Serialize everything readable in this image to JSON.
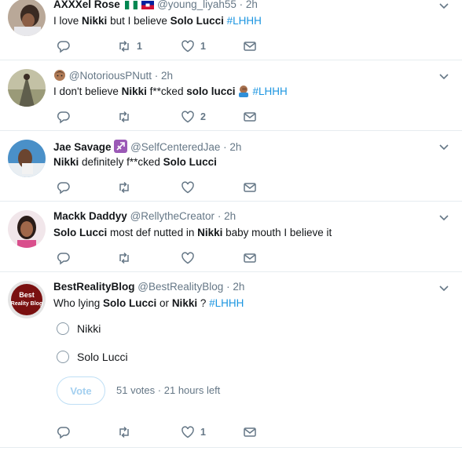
{
  "colors": {
    "accent": "#1b95e0",
    "meta": "#657786",
    "divider": "#e6ecf0"
  },
  "tweets": [
    {
      "name": "AXXXel Rose",
      "flags": [
        "nigeria-flag",
        "haiti-flag"
      ],
      "handle": "@young_liyah55",
      "time": "· 2h",
      "text": [
        {
          "t": "I love "
        },
        {
          "t": "Nikki",
          "b": true
        },
        {
          "t": " but I believe "
        },
        {
          "t": "Solo Lucci",
          "b": true
        },
        {
          "t": "  #LHHH",
          "tag": true
        }
      ],
      "retweets": "1",
      "likes": "1"
    },
    {
      "name": "@NotoriousPNutt",
      "time": "· 2h",
      "text": [
        {
          "t": "I don't believe "
        },
        {
          "t": "Nikki",
          "b": true
        },
        {
          "t": " f**cked "
        },
        {
          "t": "solo lucci",
          "b": true
        },
        {
          "t": "#LHHH",
          "tag": true
        }
      ],
      "retweets": "",
      "likes": "2"
    },
    {
      "name": "Jae Savage",
      "handle": "@SelfCenteredJae",
      "time": "· 2h",
      "text": [
        {
          "t": "Nikki",
          "b": true
        },
        {
          "t": " definitely f**cked "
        },
        {
          "t": "Solo Lucci",
          "b": true
        }
      ],
      "retweets": "",
      "likes": ""
    },
    {
      "name": "Mackk Daddyy",
      "handle": "@RellytheCreator",
      "time": "· 2h",
      "text": [
        {
          "t": "Solo Lucci",
          "b": true
        },
        {
          "t": "  most def nutted in "
        },
        {
          "t": "Nikki",
          "b": true
        },
        {
          "t": " baby mouth I believe it"
        }
      ],
      "retweets": "",
      "likes": ""
    },
    {
      "name": "BestRealityBlog",
      "handle": "@BestRealityBlog",
      "time": "· 2h",
      "text": [
        {
          "t": "Who lying "
        },
        {
          "t": "Solo Lucci",
          "b": true
        },
        {
          "t": " or "
        },
        {
          "t": "Nikki",
          "b": true
        },
        {
          "t": " ? "
        },
        {
          "t": "#LHHH",
          "tag": true
        }
      ],
      "poll": {
        "options": [
          "Nikki",
          "Solo Lucci"
        ],
        "vote_label": "Vote",
        "votes": "51 votes",
        "time_left": "21 hours left",
        "separator": "·"
      },
      "retweets": "",
      "likes": "1"
    }
  ]
}
